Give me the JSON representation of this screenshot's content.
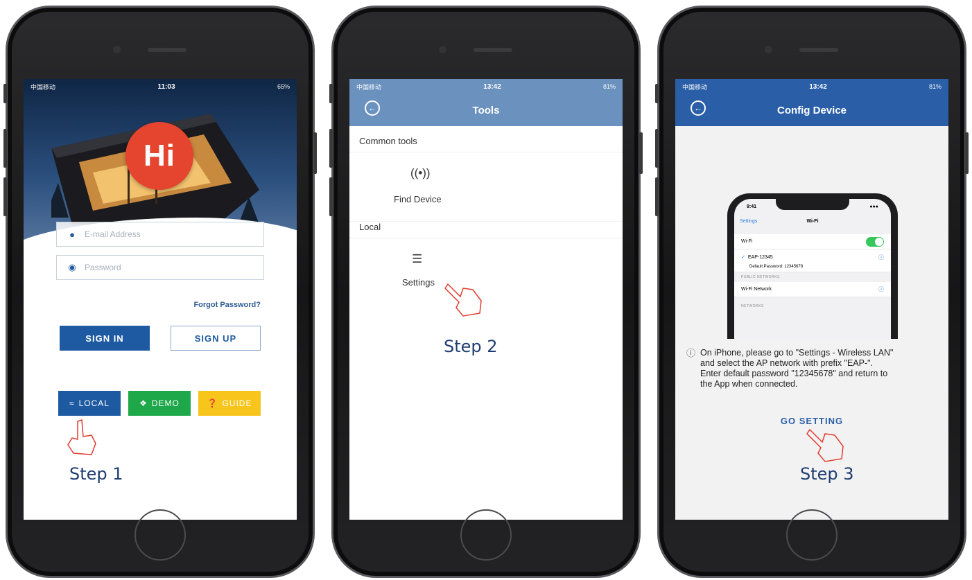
{
  "phone1": {
    "status": {
      "carrier": "中国移动",
      "time": "11:03",
      "battery": "65%"
    },
    "logo_text": "Hi",
    "email_placeholder": "E-mail Address",
    "password_placeholder": "Password",
    "forgot": "Forgot Password?",
    "sign_in": "SIGN IN",
    "sign_up": "SIGN UP",
    "local": "LOCAL",
    "demo": "DEMO",
    "guide": "GUIDE",
    "step": "Step 1"
  },
  "phone2": {
    "status": {
      "carrier": "中国移动",
      "time": "13:42",
      "battery": "81%"
    },
    "title": "Tools",
    "section_common": "Common tools",
    "find_device": "Find Device",
    "section_local": "Local",
    "settings": "Settings",
    "step": "Step 2"
  },
  "phone3": {
    "status": {
      "carrier": "中国移动",
      "time": "13:42",
      "battery": "81%"
    },
    "title": "Config Device",
    "mini": {
      "time": "9:41",
      "back": "Settings",
      "title": "Wi-Fi",
      "wifi_label": "Wi-Fi",
      "ssid": "EAP-12345",
      "default_pw": "Default Password: 12345678",
      "public_networks": "PUBLIC NETWORKS",
      "wifi_network": "Wi-Fi Network",
      "networks": "NETWORKS"
    },
    "help_lines": [
      "On iPhone, please go to \"Settings - Wireless LAN\"",
      "and select the AP network with prefix \"EAP-\".",
      "Enter default password \"12345678\" and return to",
      "the App when connected."
    ],
    "go_setting": "GO SETTING",
    "step": "Step 3"
  },
  "colors": {
    "brand_blue": "#1e5aa2",
    "demo_green": "#1ea84a",
    "guide_yellow": "#f7c51c",
    "logo_red": "#e5442f",
    "tools_header": "#6b92bf",
    "config_header": "#2a5fa7",
    "annotation_red": "#e23b2e"
  }
}
